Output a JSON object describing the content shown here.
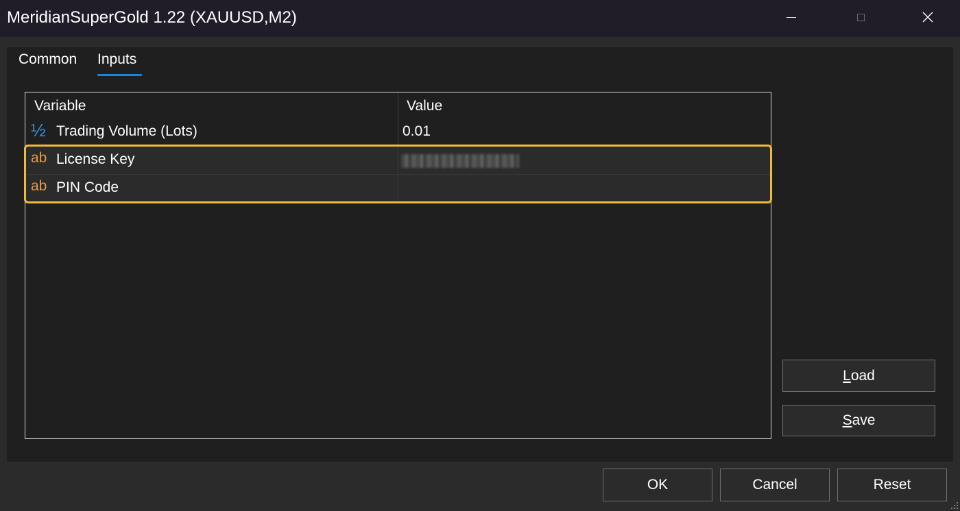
{
  "window": {
    "title": "MeridianSuperGold 1.22 (XAUUSD,M2)"
  },
  "tabs": [
    {
      "label": "Common",
      "active": false
    },
    {
      "label": "Inputs",
      "active": true
    }
  ],
  "grid": {
    "headers": {
      "variable": "Variable",
      "value": "Value"
    },
    "rows": [
      {
        "type_icon": "fraction-icon",
        "icon_glyph": "½",
        "variable": "Trading Volume (Lots)",
        "value": "0.01"
      },
      {
        "type_icon": "string-icon",
        "icon_glyph": "ab",
        "variable": "License Key",
        "value": ""
      },
      {
        "type_icon": "string-icon",
        "icon_glyph": "ab",
        "variable": "PIN Code",
        "value": ""
      }
    ]
  },
  "side_buttons": {
    "load_mnemonic": "L",
    "load_rest": "oad",
    "save_mnemonic": "S",
    "save_rest": "ave"
  },
  "footer_buttons": {
    "ok": "OK",
    "cancel": "Cancel",
    "reset": "Reset"
  },
  "colors": {
    "accent": "#1c84d6",
    "highlight": "#f4b83a",
    "fraction_icon": "#3c8ee4",
    "string_icon": "#e09a52"
  }
}
